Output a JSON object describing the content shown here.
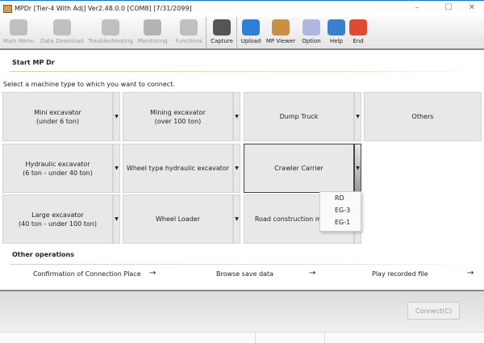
{
  "window": {
    "title": "MPDr [Tier-4 With Adj] Ver2.48.0.0 [COM8] [7/31/2099]",
    "minimize": "–",
    "maximize": "☐",
    "close": "✕"
  },
  "toolbar": [
    {
      "label": "Main Menu",
      "icon": "main-menu-icon",
      "enabled": false,
      "color": "#aaaaaa"
    },
    {
      "label": "Data Download",
      "icon": "download-icon",
      "enabled": false,
      "color": "#aaaaaa"
    },
    {
      "label": "Troubleshooting",
      "icon": "stethoscope-icon",
      "enabled": false,
      "color": "#aaaaaa"
    },
    {
      "label": "Monitoring",
      "icon": "gauge-icon",
      "enabled": false,
      "color": "#999999"
    },
    {
      "label": "Functions",
      "icon": "functions-icon",
      "enabled": false,
      "color": "#aaaaaa"
    },
    {
      "label": "Capture",
      "icon": "camera-icon",
      "enabled": true,
      "color": "#555555"
    },
    {
      "label": "Upload",
      "icon": "upload-icon",
      "enabled": true,
      "color": "#2f7fd8"
    },
    {
      "label": "MP Viewer",
      "icon": "mp-viewer-icon",
      "enabled": true,
      "color": "#c89040"
    },
    {
      "label": "Option",
      "icon": "option-icon",
      "enabled": true,
      "color": "#b0b8e0"
    },
    {
      "label": "Help",
      "icon": "help-icon",
      "enabled": true,
      "color": "#3a7fd0"
    },
    {
      "label": "End",
      "icon": "power-icon",
      "enabled": true,
      "color": "#e04a30"
    }
  ],
  "start": {
    "title": "Start MP Dr",
    "prompt": "Select a machine type to which you want to connect."
  },
  "machines": [
    {
      "label": "Mini excavator\n(under 6 ton)",
      "dropdown": true
    },
    {
      "label": "Mining excavator\n(over 100 ton)",
      "dropdown": true
    },
    {
      "label": "Dump Truck",
      "dropdown": true
    },
    {
      "label": "Others",
      "dropdown": false
    },
    {
      "label": "Hydraulic excavator\n(6 ton - under 40 ton)",
      "dropdown": true
    },
    {
      "label": "Wheel type hydraulic excavator",
      "dropdown": true
    },
    {
      "label": "Crawler Carrier",
      "dropdown": true,
      "selected": true
    },
    {
      "label": "Large excavator\n(40 ton - under 100 ton)",
      "dropdown": true
    },
    {
      "label": "Wheel Loader",
      "dropdown": true
    },
    {
      "label": "Road construction machine",
      "dropdown": true
    }
  ],
  "dropdown_arrow": "▼",
  "popup_menu": [
    "RD",
    "EG-3",
    "EG-1"
  ],
  "other": {
    "title": "Other operations",
    "items": [
      "Confirmation of Connection Place",
      "Browse save data",
      "Play recorded file"
    ],
    "arrow": "→"
  },
  "connect_label": "Connect(C)"
}
